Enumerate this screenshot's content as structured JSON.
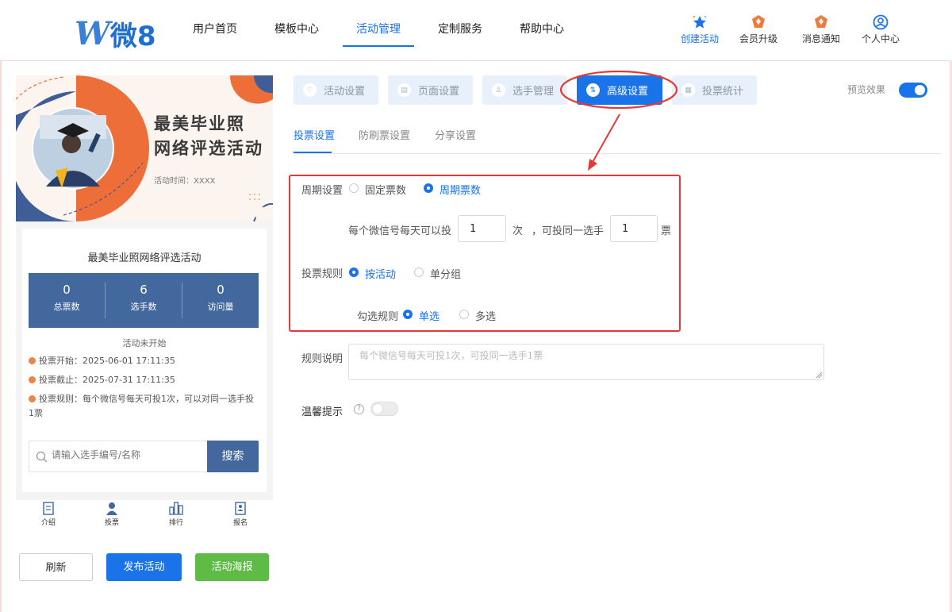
{
  "header": {
    "logo_text": "微8",
    "nav": [
      {
        "label": "用户首页"
      },
      {
        "label": "模板中心"
      },
      {
        "label": "活动管理"
      },
      {
        "label": "定制服务"
      },
      {
        "label": "帮助中心"
      }
    ],
    "actions": [
      {
        "label": "创建活动",
        "icon": "star-sparkle-icon"
      },
      {
        "label": "会员升级",
        "icon": "vip-badge-icon"
      },
      {
        "label": "消息通知",
        "icon": "bell-badge-icon"
      },
      {
        "label": "个人中心",
        "icon": "user-circle-icon"
      }
    ]
  },
  "preview": {
    "banner_title_line1": "最美毕业照",
    "banner_title_line2": "网络评选活动",
    "banner_time": "活动时间：XXXX",
    "card_title": "最美毕业照网络评选活动",
    "stats": [
      {
        "value": "0",
        "label": "总票数"
      },
      {
        "value": "6",
        "label": "选手数"
      },
      {
        "value": "0",
        "label": "访问量"
      }
    ],
    "status": "活动未开始",
    "vote_start": "投票开始：2025-06-01 17:11:35",
    "vote_end": "投票截止：2025-07-31 17:11:35",
    "vote_rule": "投票规则：每个微信号每天可投1次，可以对同一选手投1票",
    "search_placeholder": "请输入选手编号/名称",
    "search_button": "搜索",
    "tabbar": [
      {
        "label": "介绍"
      },
      {
        "label": "投票"
      },
      {
        "label": "排行"
      },
      {
        "label": "报名"
      }
    ],
    "buttons": {
      "refresh": "刷新",
      "publish": "发布活动",
      "poster": "活动海报"
    }
  },
  "tabs": [
    {
      "label": "活动设置"
    },
    {
      "label": "页面设置"
    },
    {
      "label": "选手管理"
    },
    {
      "label": "高级设置"
    },
    {
      "label": "投票统计"
    }
  ],
  "preview_toggle_label": "预览效果",
  "subtabs": [
    {
      "label": "投票设置"
    },
    {
      "label": "防刷票设置"
    },
    {
      "label": "分享设置"
    }
  ],
  "form": {
    "cycle_label": "周期设置",
    "cycle_options": [
      "固定票数",
      "周期票数"
    ],
    "per_day_text": "每个微信号每天可以投",
    "per_day_value": "1",
    "times_unit": "次",
    "same_player_text": "，可投同一选手",
    "same_player_value": "1",
    "votes_unit": "票",
    "rule_label": "投票规则",
    "rule_options": [
      "按活动",
      "单分组"
    ],
    "select_label": "勾选规则",
    "select_options": [
      "单选",
      "多选"
    ],
    "desc_label": "规则说明",
    "desc_placeholder": "每个微信号每天可投1次，可投同一选手1票",
    "tip_label": "温馨提示",
    "tip_help": "?"
  },
  "colors": {
    "accent": "#1a73e8",
    "annotation": "#e53935",
    "preview_blue": "#42689d",
    "poster_green": "#5dbb46"
  }
}
